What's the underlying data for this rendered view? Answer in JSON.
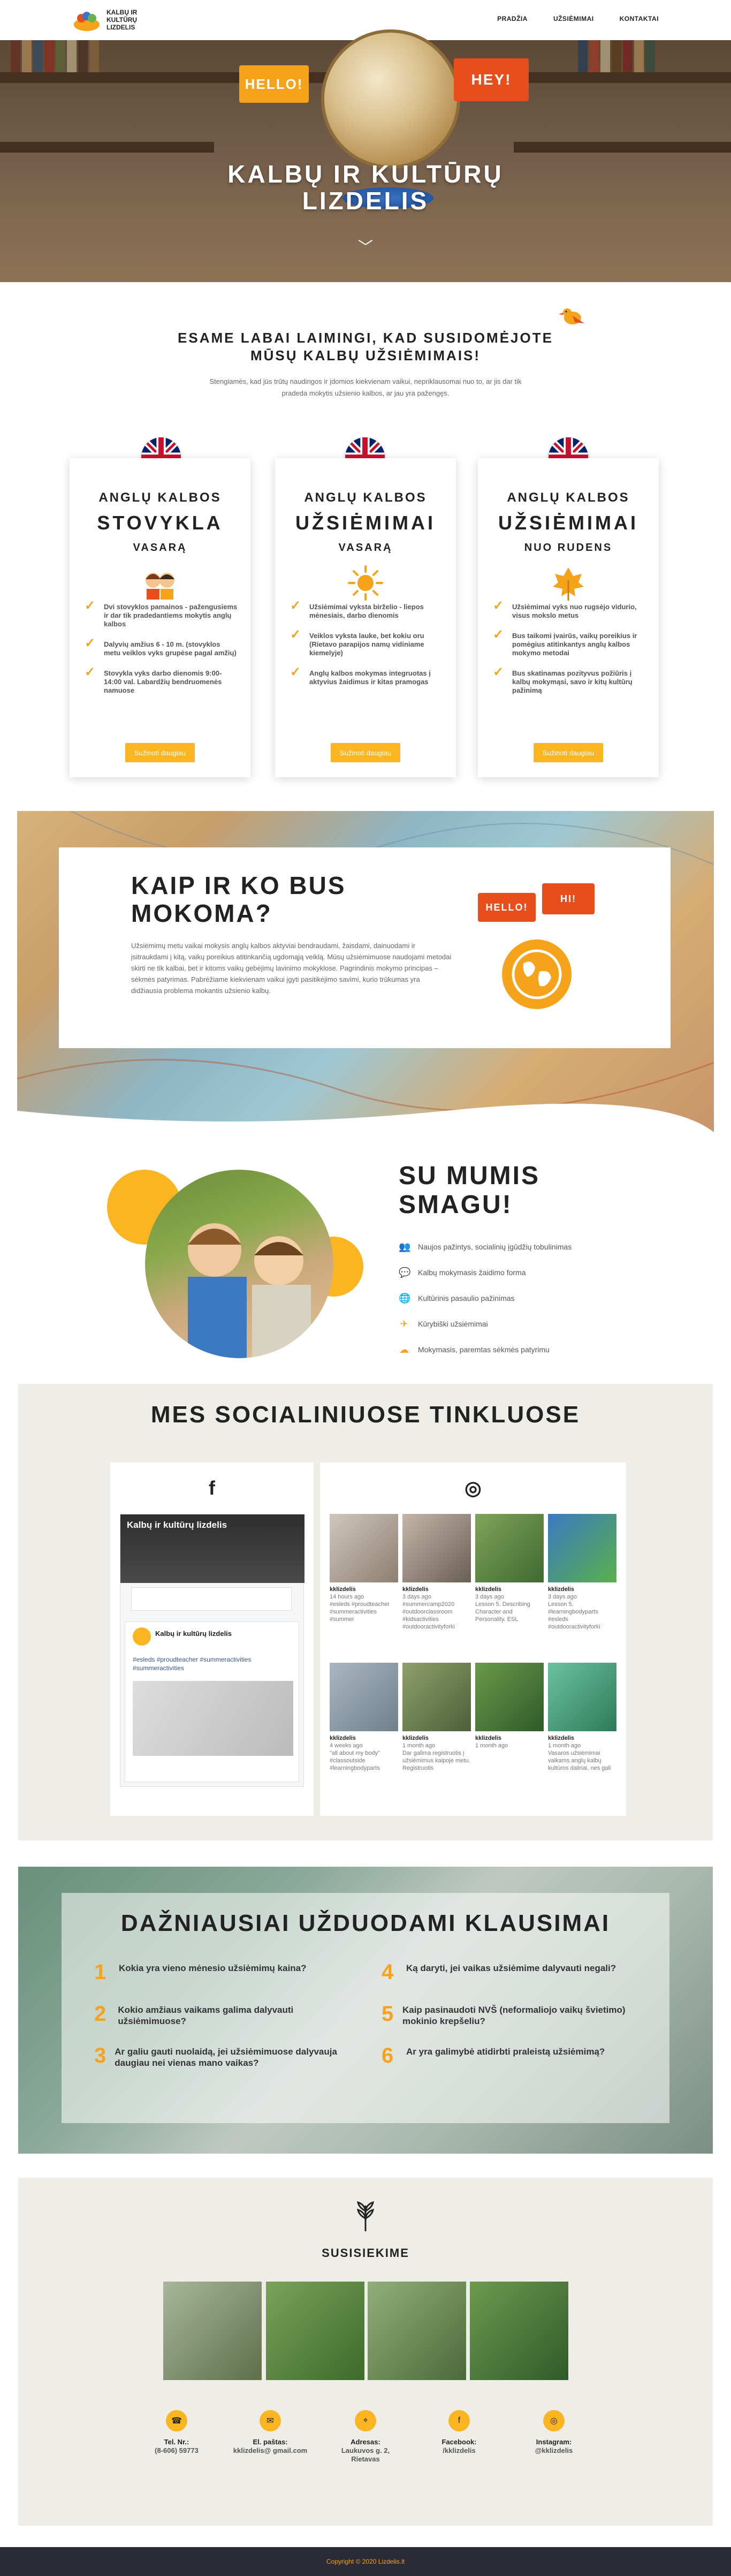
{
  "header": {
    "logo_text": "KALBŲ IR KULTŪRŲ LIZDELIS",
    "nav": [
      "PRADŽIA",
      "UŽSIĖMIMAI",
      "KONTAKTAI"
    ]
  },
  "hero": {
    "bubble_left": "HELLO!",
    "bubble_right": "HEY!",
    "title": "KALBŲ IR KULTŪRŲ LIZDELIS",
    "chevron": "﹀"
  },
  "intro": {
    "title": "ESAME LABAI LAIMINGI, KAD SUSIDOMĖJOTE MŪSŲ KALBŲ UŽSIĖMIMAIS!",
    "text": "Stengiamės, kad jūs trūtų naudingos ir įdomios kiekvienam vaikui, nepriklausomai nuo to, ar jis dar tik pradeda mokytis užsienio kalbos, ar jau yra pažengęs."
  },
  "cards": [
    {
      "t1": "ANGLŲ KALBOS",
      "t2": "STOVYKLA",
      "t3": "VASARĄ",
      "icon": "kids-icon",
      "items": [
        "Dvi stovyklos pamainos - pažengusiems ir dar tik pradedantiems mokytis anglų kalbos",
        "Dalyvių amžius 6 - 10 m. (stovyklos metu veiklos vyks grupėse pagal amžių)",
        "Stovykla vyks darbo dienomis 9:00-14:00 val. Labardžių bendruomenės namuose"
      ],
      "button": "Sužinoti daugiau"
    },
    {
      "t1": "ANGLŲ KALBOS",
      "t2": "UŽSIĖMIMAI",
      "t3": "VASARĄ",
      "icon": "sun-icon",
      "items": [
        "Užsiėmimai vyksta birželio - liepos mėnesiais, darbo dienomis",
        "Veiklos vyksta lauke, bet kokiu oru (Rietavo parapijos namų vidiniame kiemelyje)",
        "Anglų kalbos mokymas integruotas į aktyvius žaidimus ir kitas pramogas"
      ],
      "button": "Sužinoti daugiau"
    },
    {
      "t1": "ANGLŲ KALBOS",
      "t2": "UŽSIĖMIMAI",
      "t3": "NUO RUDENS",
      "icon": "leaf-icon",
      "items": [
        "Užsiėmimai vyks nuo rugsėjo vidurio, visus mokslo metus",
        "Bus taikomi įvairūs, vaikų poreikius ir pomėgius atitinkantys anglų kalbos mokymo metodai",
        "Bus skatinamas pozityvus požiūris į kalbų mokymąsi, savo ir kitų kultūrų pažinimą"
      ],
      "button": "Sužinoti daugiau"
    }
  ],
  "howto": {
    "title": "KAIP IR KO BUS MOKOMA?",
    "text": "Užsiėmimų metu vaikai mokysis anglų kalbos aktyviai bendraudami, žaisdami, dainuodami ir įsitraukdami į kitą, vaikų poreikius atitinkančią ugdomąją veiklą. Mūsų užsiėmimuose naudojami metodai skirti ne tik kalbai, bet ir kitoms vaikų gebėjimų lavinimo mokyklose. Pagrindinis mokymo principas – sėkmės patyrimas. Pabrėžiame kiekvienam vaikui įgyti pasitikėjimo savimi, kurio trūkumas yra didžiausia problema mokantis užsienio kalbų.",
    "bubble_left": "HELLO!",
    "bubble_right": "HI!"
  },
  "fun": {
    "title": "SU MUMIS SMAGU!",
    "items": [
      {
        "icon": "people-icon",
        "text": "Naujos pažintys, socialinių įgūdžių tobulinimas"
      },
      {
        "icon": "chat-icon",
        "text": "Kalbų mokymasis žaidimo forma"
      },
      {
        "icon": "globe-icon",
        "text": "Kultūrinis pasaulio pažinimas"
      },
      {
        "icon": "plane-icon",
        "text": "Kūrybiški užsiėmimai"
      },
      {
        "icon": "cloud-icon",
        "text": "Mokymasis, paremtas sėkmės patyrimu"
      }
    ]
  },
  "social": {
    "title": "MES SOCIALINIUOSE TINKLUOSE",
    "fb_icon": "f",
    "ig_icon": "◎",
    "fb": {
      "cover_title": "Kalbų ir kultūrų lizdelis",
      "cover_sub": "Kalbų ir kultūrų lizdelis",
      "page_name": "Kalbų ir kultūrų lizdelis",
      "tags": "#esleds #proudteacher #summeractivities #summeractivities"
    },
    "ig": [
      {
        "user": "kklizdelis",
        "time": "14 hours ago",
        "text": "#esleds #proudteacher #summeractivities #summer"
      },
      {
        "user": "kklizdelis",
        "time": "3 days ago",
        "text": "#summercamp2020 #outdoorclassroom #kidsactivities #outdooractivityforki"
      },
      {
        "user": "kklizdelis",
        "time": "3 days ago",
        "text": "Lesson 5. Describing Character and Personality. ESL"
      },
      {
        "user": "kklizdelis",
        "time": "3 days ago",
        "text": "Lesson 5. #learningbodyparts #esleds #outdooractivityforki"
      },
      {
        "user": "kklizdelis",
        "time": "4 weeks ago",
        "text": "\"all about my body\" #classoutside #learningbodyparts"
      },
      {
        "user": "kklizdelis",
        "time": "1 month ago",
        "text": "Dar galima registruotis į užsiėmimus kaipoje metu. Registruotis"
      },
      {
        "user": "kklizdelis",
        "time": "1 month ago",
        "text": ""
      },
      {
        "user": "kklizdelis",
        "time": "1 month ago",
        "text": "Vasaros užsiėmimai vaikams anglų kalbų kultūros dalinai, nes gali"
      }
    ]
  },
  "faq": {
    "title": "DAŽNIAUSIAI UŽDUODAMI KLAUSIMAI",
    "items": [
      {
        "n": "1",
        "q": "Kokia yra vieno mėnesio užsiėmimų kaina?"
      },
      {
        "n": "2",
        "q": "Kokio amžiaus vaikams galima dalyvauti užsiėmimuose?"
      },
      {
        "n": "3",
        "q": "Ar galiu gauti nuolaidą, jei užsiėmimuose dalyvauja daugiau nei vienas mano vaikas?"
      },
      {
        "n": "4",
        "q": "Ką daryti, jei vaikas užsiėmime dalyvauti negali?"
      },
      {
        "n": "5",
        "q": "Kaip pasinaudoti NVŠ (neformaliojo vaikų švietimo) mokinio krepšeliu?"
      },
      {
        "n": "6",
        "q": "Ar yra galimybė atidirbti praleistą užsiėmimą?"
      }
    ]
  },
  "contact": {
    "title": "SUSISIEKIME",
    "items": [
      {
        "icon": "phone-icon",
        "glyph": "☎",
        "label": "Tel. Nr.:",
        "value": "(8-606) 59773"
      },
      {
        "icon": "mail-icon",
        "glyph": "✉",
        "label": "El. paštas:",
        "value": "kklizdelis@ gmail.com"
      },
      {
        "icon": "pin-icon",
        "glyph": "⌖",
        "label": "Adresas:",
        "value": "Laukuvos g. 2, Rietavas"
      },
      {
        "icon": "facebook-icon",
        "glyph": "f",
        "label": "Facebook:",
        "value": "/kklizdelis"
      },
      {
        "icon": "instagram-icon",
        "glyph": "◎",
        "label": "Instagram:",
        "value": "@kklizdelis"
      }
    ]
  },
  "footer": {
    "text": "Copyright © 2020 Lizdelis.lt"
  },
  "colors": {
    "accent": "#fbb521",
    "orange": "#f6a31c",
    "red": "#e84e1b",
    "bg_grey": "#eeede8",
    "footer": "#2a2b34"
  }
}
